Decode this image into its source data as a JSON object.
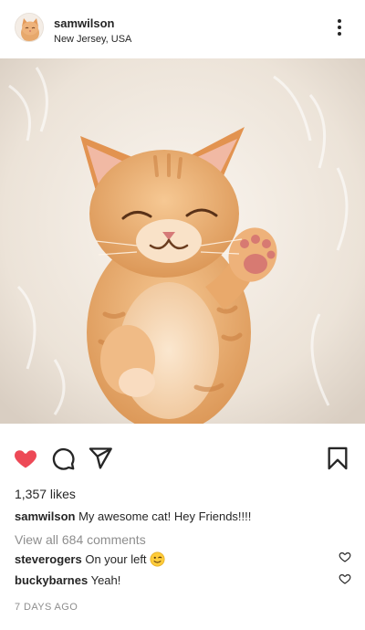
{
  "post": {
    "username": "samwilson",
    "location": "New Jersey, USA",
    "likes": "1,357 likes",
    "caption_text": "My awesome cat! Hey Friends!!!!",
    "view_all": "View all 684 comments",
    "time_ago": "7 DAYS AGO",
    "liked": true
  },
  "comments": [
    {
      "user": "steverogers",
      "text": "On your left",
      "emoji": "winking-face"
    },
    {
      "user": "buckybarnes",
      "text": "Yeah!"
    }
  ],
  "colors": {
    "like_red": "#ed4956",
    "text": "#262626",
    "muted": "#8e8e8e"
  },
  "icons": [
    "more-vertical-icon",
    "heart-icon",
    "comment-icon",
    "share-icon",
    "bookmark-icon"
  ]
}
